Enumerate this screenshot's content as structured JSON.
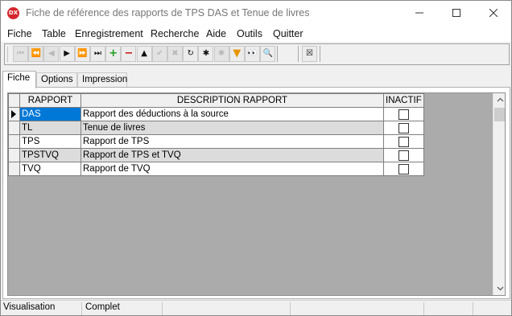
{
  "window": {
    "icon_label": "DX",
    "title": "Fiche de référence des rapports de TPS DAS et Tenue de livres"
  },
  "menu": [
    "Fiche",
    "Table",
    "Enregistrement",
    "Recherche",
    "Aide",
    "Outils",
    "Quitter"
  ],
  "toolbar": {
    "buttons": [
      {
        "name": "first-record-button",
        "glyph": "⏮",
        "enabled": false
      },
      {
        "name": "prev-page-button",
        "glyph": "⏪",
        "enabled": false
      },
      {
        "name": "prev-record-button",
        "glyph": "◀",
        "enabled": false
      },
      {
        "name": "next-record-button",
        "glyph": "▶",
        "enabled": true
      },
      {
        "name": "next-page-button",
        "glyph": "⏩",
        "enabled": true
      },
      {
        "name": "last-record-button",
        "glyph": "⏭",
        "enabled": true
      },
      {
        "name": "add-button",
        "glyph": "+",
        "enabled": true,
        "color": "#1a9e1a"
      },
      {
        "name": "delete-button",
        "glyph": "−",
        "enabled": true,
        "color": "#cc1111"
      },
      {
        "name": "move-up-button",
        "glyph": "▲",
        "enabled": true
      },
      {
        "name": "confirm-button",
        "glyph": "✔",
        "enabled": false
      },
      {
        "name": "cancel-edit-button",
        "glyph": "✖",
        "enabled": false
      },
      {
        "name": "refresh-button",
        "glyph": "↻",
        "enabled": true
      },
      {
        "name": "asterisk-button",
        "glyph": "✱",
        "enabled": true
      },
      {
        "name": "asterisk-disabled-button",
        "glyph": "✱",
        "enabled": false
      },
      {
        "name": "filter-button",
        "glyph": "▼",
        "enabled": true,
        "color": "#e69500"
      },
      {
        "name": "binoculars-button",
        "glyph": "👀",
        "enabled": true
      },
      {
        "name": "search-button",
        "glyph": "🔍",
        "enabled": true
      },
      {
        "name": "close-record-button",
        "glyph": "☒",
        "enabled": true
      }
    ]
  },
  "tabs": [
    "Fiche",
    "Options",
    "Impression"
  ],
  "grid": {
    "columns": [
      "RAPPORT",
      "DESCRIPTION RAPPORT",
      "INACTIF"
    ],
    "rows": [
      {
        "code": "DAS",
        "description": "Rapport des déductions à la source",
        "inactif": false
      },
      {
        "code": "TL",
        "description": "Tenue de livres",
        "inactif": false
      },
      {
        "code": "TPS",
        "description": "Rapport de TPS",
        "inactif": false
      },
      {
        "code": "TPSTVQ",
        "description": "Rapport de TPS et TVQ",
        "inactif": false
      },
      {
        "code": "TVQ",
        "description": "Rapport de TVQ",
        "inactif": false
      }
    ]
  },
  "status": {
    "mode": "Visualisation",
    "state": "Complet"
  }
}
